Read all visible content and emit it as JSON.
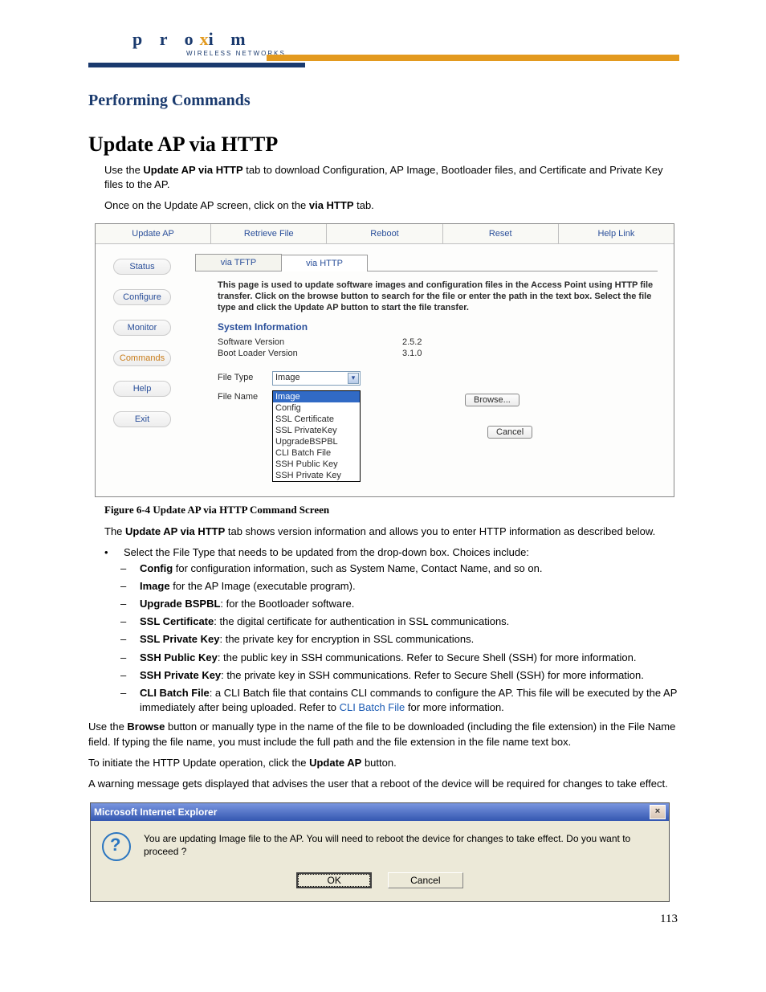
{
  "header": {
    "brand_p": "p r o",
    "brand_x": "x",
    "brand_im": "i m",
    "brand_sub": "WIRELESS NETWORKS"
  },
  "section_title": "Performing Commands",
  "title": "Update AP via HTTP",
  "intro_prefix": "Use the ",
  "intro_bold": "Update AP via HTTP",
  "intro_suffix": " tab to download Configuration, AP Image, Bootloader files, and Certificate and Private Key files to the AP.",
  "intro2_prefix": "Once on the Update AP screen, click on the ",
  "intro2_bold": "via HTTP",
  "intro2_suffix": " tab.",
  "ap": {
    "tabs": [
      "Update AP",
      "Retrieve File",
      "Reboot",
      "Reset",
      "Help Link"
    ],
    "nav": [
      "Status",
      "Configure",
      "Monitor",
      "Commands",
      "Help",
      "Exit"
    ],
    "subtabs": [
      "via TFTP",
      "via HTTP"
    ],
    "desc": "This page is used to update software images and configuration files in the Access Point using HTTP file transfer. Click on the browse button to search for the file or enter the path in the text box. Select the file type and click the Update AP button to start the file transfer.",
    "sysinfo_title": "System Information",
    "sw_label": "Software Version",
    "sw_value": "2.5.2",
    "bl_label": "Boot Loader Version",
    "bl_value": "3.1.0",
    "filetype_label": "File Type",
    "filename_label": "File Name",
    "select_value": "Image",
    "options": [
      "Image",
      "Config",
      "SSL Certificate",
      "SSL PrivateKey",
      "UpgradeBSPBL",
      "CLI Batch File",
      "SSH Public Key",
      "SSH Private Key"
    ],
    "browse": "Browse...",
    "cancel": "Cancel"
  },
  "figure_caption": "Figure 6-4     Update AP via HTTP Command Screen",
  "para1_prefix": "The ",
  "para1_bold": "Update AP via HTTP",
  "para1_suffix": " tab shows version information and allows you to enter HTTP information as described below.",
  "bullet_intro": "Select the File Type that needs to be updated from the drop-down box. Choices include:",
  "items": {
    "config_b": "Config",
    "config_t": " for configuration information, such as System Name, Contact Name, and so on.",
    "image_b": "Image",
    "image_t": " for the AP Image (executable program).",
    "upgrade_b": "Upgrade BSPBL",
    "upgrade_t": ": for the Bootloader software.",
    "sslc_b": "SSL Certificate",
    "sslc_t": ": the digital certificate for authentication in SSL communications.",
    "sslp_b": "SSL Private Key",
    "sslp_t": ": the private key for encryption in SSL communications.",
    "sshpub_b": "SSH Public Key",
    "sshpub_t": ": the public key in SSH communications. Refer to Secure Shell (SSH) for more information.",
    "sshpriv_b": "SSH Private Key",
    "sshpriv_t": ": the private key in SSH communications. Refer to Secure Shell (SSH) for more information.",
    "cli_b": "CLI Batch File",
    "cli_t1": ": a CLI Batch file that contains CLI commands to configure the AP. This file will be executed by the AP immediately after being uploaded. Refer to ",
    "cli_link": "CLI Batch File",
    "cli_t2": " for more information."
  },
  "para_browse_pre": "Use the ",
  "para_browse_b": "Browse",
  "para_browse_suf": " button or manually type in the name of the file to be downloaded (including the file extension) in the File Name field. If typing the file name, you must include the full path and the file extension in the file name text box.",
  "para_initiate_pre": "To initiate the HTTP Update operation, click the ",
  "para_initiate_b": "Update AP",
  "para_initiate_suf": " button.",
  "para_warning": "A warning message gets displayed that advises the user that a reboot of the device will be required for changes to take effect.",
  "ie": {
    "title": "Microsoft Internet Explorer",
    "message": "You are updating Image file to the AP. You will need to reboot the device for changes to take effect. Do you want to proceed ?",
    "ok": "OK",
    "cancel": "Cancel"
  },
  "page_number": "113"
}
